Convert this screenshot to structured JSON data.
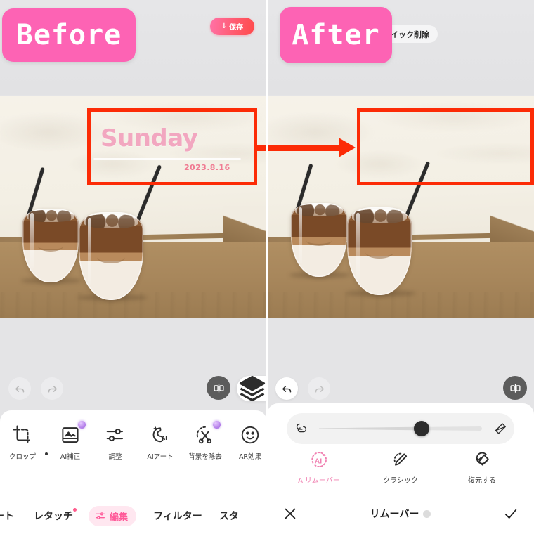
{
  "annotations": {
    "before_label": "Before",
    "after_label": "After",
    "accent_pink": "#fd63b4",
    "highlight_red": "#fc2b06"
  },
  "before_panel": {
    "top_bar": {
      "save_button_label": "保存",
      "save_button_icon": "download-arrow-icon",
      "quick_remove_label": "イック削除"
    },
    "photo": {
      "watermark_text": "Sunday",
      "watermark_date": "2023.8.16",
      "description": "two iced latte glasses with black straws on wooden table"
    },
    "controls": {
      "undo_icon": "undo-arrow-icon",
      "redo_icon": "redo-arrow-icon",
      "compare_icon": "compare-split-icon",
      "layers_icon": "layers-stack-icon"
    },
    "tools": [
      {
        "label": "クロップ",
        "icon": "crop-icon",
        "badge": false
      },
      {
        "label": "AI補正",
        "icon": "ai-enhance-image-icon",
        "badge": true
      },
      {
        "label": "調整",
        "icon": "adjust-sliders-icon",
        "badge": false
      },
      {
        "label": "AIアート",
        "icon": "ai-art-icon",
        "badge": false
      },
      {
        "label": "背景を除去",
        "icon": "remove-background-scissors-icon",
        "badge": true
      },
      {
        "label": "AR効果",
        "icon": "ar-effect-smiley-icon",
        "badge": false
      }
    ],
    "nav": [
      {
        "label": "レート",
        "active": false,
        "dot": false
      },
      {
        "label": "レタッチ",
        "active": false,
        "dot": true
      },
      {
        "label": "編集",
        "active": true,
        "dot": false
      },
      {
        "label": "フィルター",
        "active": false,
        "dot": false
      },
      {
        "label": "スタ",
        "active": false,
        "dot": false
      }
    ]
  },
  "after_panel": {
    "controls": {
      "undo_icon": "undo-arrow-icon",
      "redo_icon": "redo-arrow-icon",
      "compare_icon": "compare-split-icon"
    },
    "brush": {
      "size_icon": "brush-size-icon",
      "eraser_icon": "eraser-icon",
      "slider_value_percent": 62
    },
    "modes": [
      {
        "label": "AIリムーバー",
        "icon": "ai-remover-icon",
        "active": true
      },
      {
        "label": "クラシック",
        "icon": "classic-pencil-icon",
        "active": false
      },
      {
        "label": "復元する",
        "icon": "restore-brush-icon",
        "active": false
      }
    ],
    "confirm_bar": {
      "cancel_icon": "close-x-icon",
      "title": "リムーバー",
      "info_icon": "info-dot-icon",
      "apply_icon": "check-icon"
    }
  }
}
